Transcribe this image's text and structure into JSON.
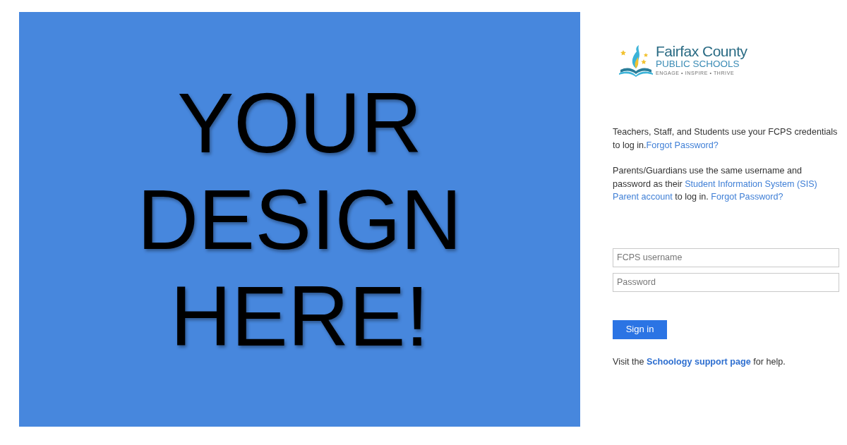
{
  "hero": {
    "lines": [
      "YOUR",
      "DESIGN",
      "HERE!"
    ]
  },
  "logo": {
    "name": "Fairfax County",
    "subtitle": "PUBLIC SCHOOLS",
    "tagline": "ENGAGE • INSPIRE • THRIVE"
  },
  "paragraphs": [
    [
      {
        "kind": "text",
        "text": "Teachers, Staff, and Students use your FCPS credentials to log in."
      },
      {
        "kind": "link",
        "text": "Forgot Password?"
      }
    ],
    [
      {
        "kind": "text",
        "text": "Parents/Guardians use the same username and password as their "
      },
      {
        "kind": "link",
        "text": "Student Information System (SIS)"
      },
      {
        "kind": "link",
        "text": "Parent account"
      },
      {
        "kind": "text",
        "text": " to log in. "
      },
      {
        "kind": "link",
        "text": "Forgot Password?"
      }
    ]
  ],
  "fields": [
    {
      "placeholder": "FCPS username"
    },
    {
      "placeholder": "Password"
    }
  ],
  "sign_in_button": "Sign in",
  "help": [
    {
      "kind": "text",
      "text": "Visit the "
    },
    {
      "kind": "link",
      "text": "Schoology support page"
    },
    {
      "kind": "text",
      "text": " for help."
    }
  ]
}
